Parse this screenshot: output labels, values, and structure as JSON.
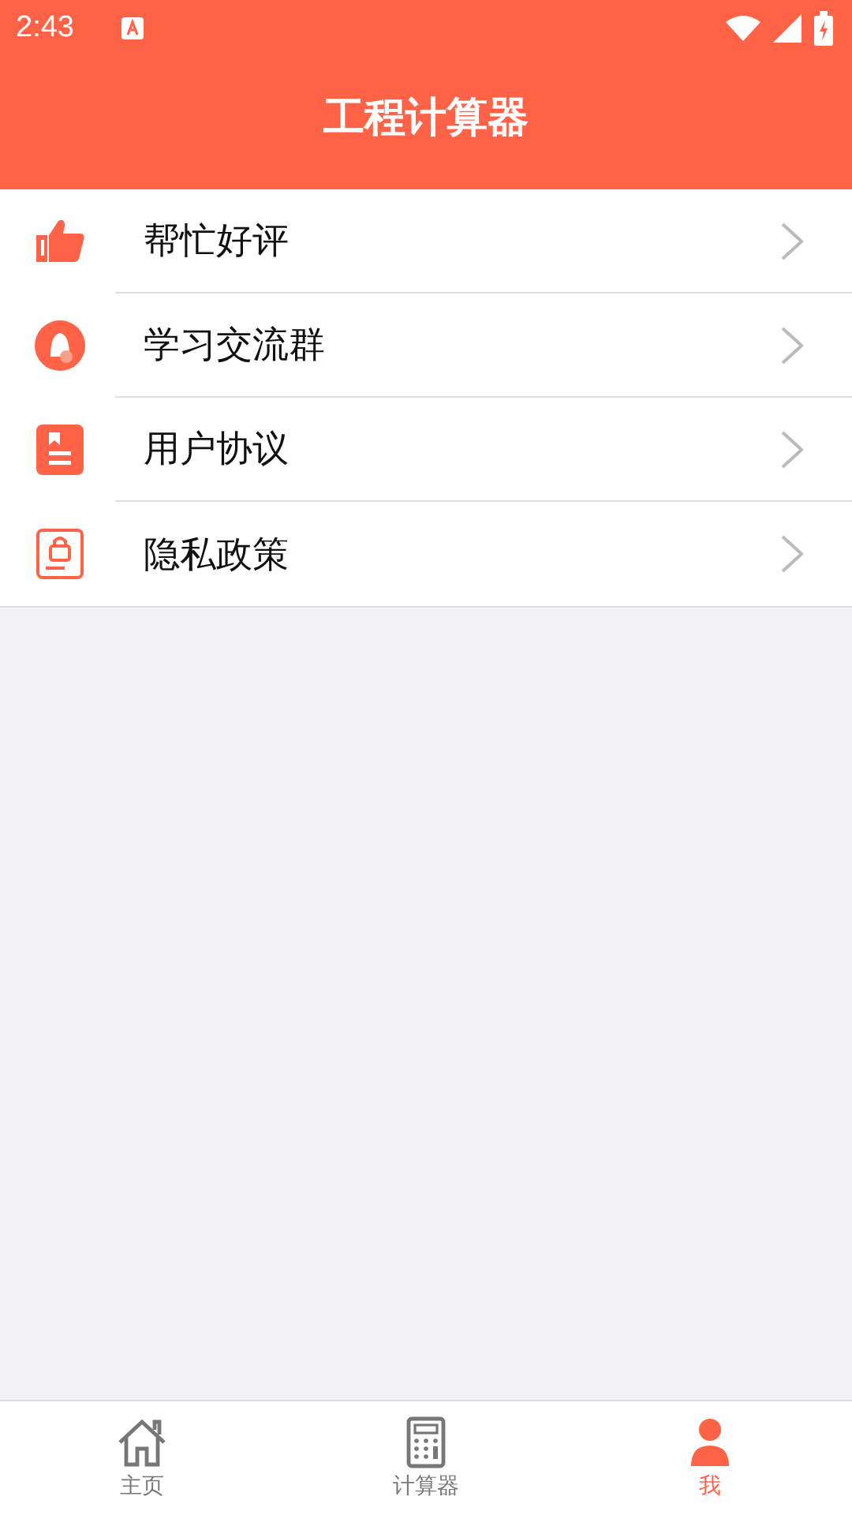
{
  "status_bar": {
    "time": "2:43"
  },
  "header": {
    "title": "工程计算器"
  },
  "menu": [
    {
      "kind": "thumb",
      "label": "帮忙好评"
    },
    {
      "kind": "group",
      "label": "学习交流群"
    },
    {
      "kind": "book",
      "label": "用户协议"
    },
    {
      "kind": "lock",
      "label": "隐私政策"
    }
  ],
  "tab_bar": [
    {
      "kind": "home",
      "label": "主页",
      "selected": false
    },
    {
      "kind": "calc",
      "label": "计算器",
      "selected": false
    },
    {
      "kind": "user",
      "label": "我",
      "selected": true
    }
  ]
}
